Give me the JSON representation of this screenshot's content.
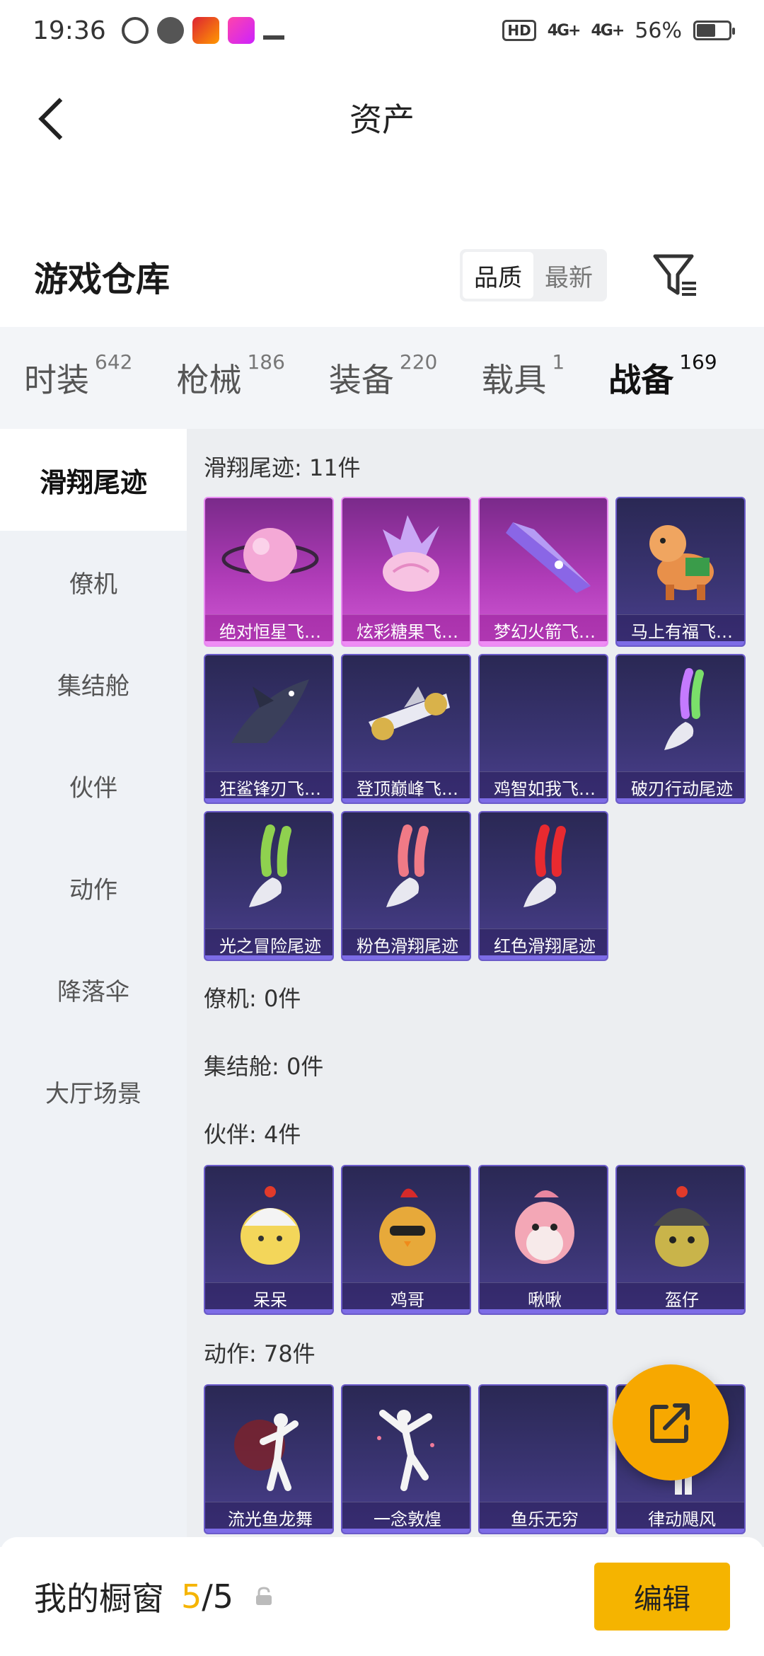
{
  "status_bar": {
    "time": "19:36",
    "battery": "56%",
    "network": "4G+",
    "hd": "HD"
  },
  "header": {
    "title": "资产"
  },
  "warehouse": {
    "title": "游戏仓库",
    "sort_options": [
      "品质",
      "最新"
    ],
    "active_sort": "品质"
  },
  "tabs": [
    {
      "label": "时装",
      "count": "642"
    },
    {
      "label": "枪械",
      "count": "186"
    },
    {
      "label": "装备",
      "count": "220"
    },
    {
      "label": "载具",
      "count": "1"
    },
    {
      "label": "战备",
      "count": "169"
    }
  ],
  "active_tab": "战备",
  "sidenav": [
    "滑翔尾迹",
    "僚机",
    "集结舱",
    "伙伴",
    "动作",
    "降落伞",
    "大厅场景"
  ],
  "active_side": "滑翔尾迹",
  "sections": {
    "trail": {
      "title": "滑翔尾迹: 11件",
      "items": [
        {
          "label": "绝对恒星飞…",
          "rarity": "pink",
          "icon": "planet-icon"
        },
        {
          "label": "炫彩糖果飞…",
          "rarity": "pink",
          "icon": "candy-icon"
        },
        {
          "label": "梦幻火箭飞…",
          "rarity": "pink",
          "icon": "rocket-wing-icon"
        },
        {
          "label": "马上有福飞…",
          "rarity": "purple",
          "icon": "horse-icon"
        },
        {
          "label": "狂鲨锋刃飞…",
          "rarity": "purple",
          "icon": "shark-icon"
        },
        {
          "label": "登顶巅峰飞…",
          "rarity": "purple",
          "icon": "jet-icon"
        },
        {
          "label": "鸡智如我飞…",
          "rarity": "purple",
          "icon": "blank-icon"
        },
        {
          "label": "破刃行动尾迹",
          "rarity": "purple",
          "icon": "smoke-rainbow-icon"
        },
        {
          "label": "光之冒险尾迹",
          "rarity": "purple",
          "icon": "smoke-green-icon"
        },
        {
          "label": "粉色滑翔尾迹",
          "rarity": "purple",
          "icon": "smoke-pink-icon"
        },
        {
          "label": "红色滑翔尾迹",
          "rarity": "purple",
          "icon": "smoke-red-icon"
        }
      ]
    },
    "wingman": {
      "title": "僚机: 0件"
    },
    "pod": {
      "title": "集结舱: 0件"
    },
    "partner": {
      "title": "伙伴: 4件",
      "items": [
        {
          "label": "呆呆",
          "icon": "chick-icon"
        },
        {
          "label": "鸡哥",
          "icon": "rooster-icon"
        },
        {
          "label": "啾啾",
          "icon": "bird-icon"
        },
        {
          "label": "盔仔",
          "icon": "helmet-bird-icon"
        }
      ]
    },
    "emote": {
      "title": "动作: 78件",
      "items": [
        {
          "label": "流光鱼龙舞",
          "icon": "dancer-icon"
        },
        {
          "label": "一念敦煌",
          "icon": "dancer-icon"
        },
        {
          "label": "鱼乐无穷",
          "icon": "blank-icon"
        },
        {
          "label": "律动飓风",
          "icon": "dancer-icon"
        }
      ]
    }
  },
  "showcase": {
    "label": "我的橱窗",
    "current": "5",
    "separator": "/",
    "total": "5"
  },
  "edit_button": "编辑",
  "colors": {
    "accent": "#f5b400",
    "card_purple": "#3b3574",
    "card_pink": "#b03cb8"
  }
}
